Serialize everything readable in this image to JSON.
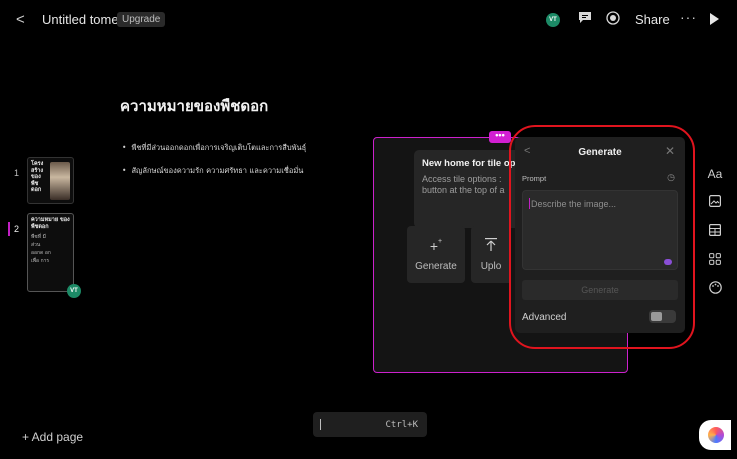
{
  "topbar": {
    "back_icon": "chevron-left-icon",
    "title": "Untitled tome",
    "upgrade_label": "Upgrade",
    "avatar_initials": "VT",
    "share_label": "Share",
    "more_icon": "···"
  },
  "page": {
    "heading": "ความหมายของพืชดอก",
    "bullets": [
      "พืชที่มีส่วนออกดอกเพื่อการเจริญเติบโตและการสืบพันธุ์",
      "สัญลักษณ์ของความรัก ความศรัทธา และความเชื่อมั่น"
    ]
  },
  "thumbnails": [
    {
      "number": "1",
      "title": "โครง สร้าง ของ พืช ดอก"
    },
    {
      "number": "2",
      "title": "ความหมาย ของพืชดอก",
      "body": "พืชที่ มีส่วน ออกด อก เพื่อ การ"
    }
  ],
  "thumb_avatar": "VT",
  "tile": {
    "more_label": "•••",
    "tooltip_title": "New home for tile op",
    "tooltip_body_1": "Access tile options :",
    "tooltip_body_2": "button at the top of a",
    "generate_label": "Generate",
    "upload_label": "Uplo"
  },
  "generate_panel": {
    "title": "Generate",
    "prompt_label": "Prompt",
    "prompt_placeholder": "Describe the image...",
    "generate_button": "Generate",
    "advanced_label": "Advanced",
    "advanced_enabled": false
  },
  "rail": {
    "text_label": "Aa"
  },
  "bottom": {
    "add_page_label": "+ Add page",
    "shortcut": "Ctrl+K"
  },
  "colors": {
    "accent_magenta": "#cc21cc",
    "annotation_red": "#e0141e",
    "avatar_green": "#1c8a66"
  }
}
